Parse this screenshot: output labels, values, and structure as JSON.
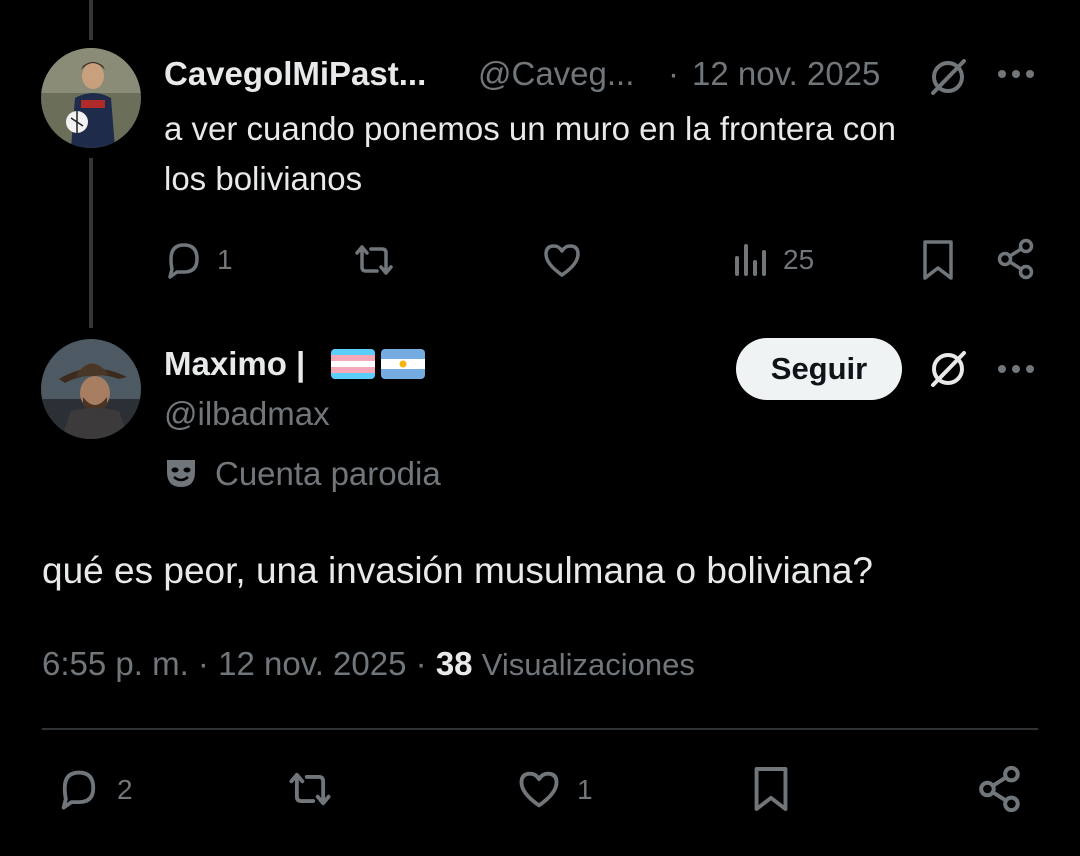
{
  "parent_post": {
    "display_name": "CavegolMiPast...",
    "handle": "@Caveg...",
    "separator": "·",
    "date": "12 nov. 2025",
    "text_line1": "a ver cuando ponemos un muro en la frontera con",
    "text_line2": "los bolivianos",
    "actions": {
      "replies": "1",
      "views": "25"
    }
  },
  "main_post": {
    "display_name": "Maximo |",
    "handle": "@ilbadmax",
    "label": "Cuenta parodia",
    "follow_label": "Seguir",
    "text": "qué es peor, una invasión musulmana o boliviana?",
    "time": "6:55 p. m.",
    "sep1": "·",
    "date": "12 nov. 2025",
    "sep2": "·",
    "views_count": "38",
    "views_label": "Visualizaciones",
    "actions": {
      "replies": "2",
      "likes": "1"
    }
  },
  "colors": {
    "background": "#000000",
    "text": "#e7e9ea",
    "muted": "#71767b",
    "button_bg": "#eff3f4"
  },
  "icons": [
    "grok-icon",
    "more-icon",
    "reply-icon",
    "repost-icon",
    "like-icon",
    "views-icon",
    "bookmark-icon",
    "share-icon",
    "parody-mask-icon"
  ]
}
